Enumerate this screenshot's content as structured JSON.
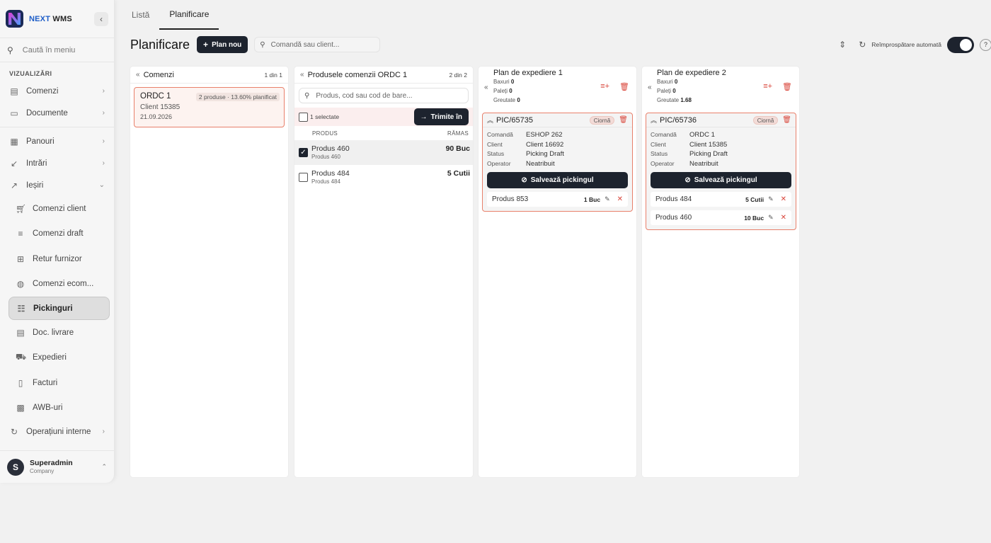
{
  "brand": {
    "name_accent": "NEXT",
    "name": "WMS"
  },
  "sidebar": {
    "search_placeholder": "Caută în meniu",
    "section": "VIZUALIZĂRI",
    "group1": [
      {
        "label": "Comenzi"
      },
      {
        "label": "Documente"
      }
    ],
    "group2": [
      {
        "label": "Panouri"
      },
      {
        "label": "Intrări"
      },
      {
        "label": "Ieșiri"
      }
    ],
    "subitems": [
      {
        "label": "Comenzi client"
      },
      {
        "label": "Comenzi draft"
      },
      {
        "label": "Retur furnizor"
      },
      {
        "label": "Comenzi ecom..."
      },
      {
        "label": "Pickinguri"
      },
      {
        "label": "Doc. livrare"
      },
      {
        "label": "Expedieri"
      },
      {
        "label": "Facturi"
      },
      {
        "label": "AWB-uri"
      }
    ],
    "group3": [
      {
        "label": "Operațiuni interne"
      }
    ],
    "user": {
      "initial": "S",
      "name": "Superadmin",
      "company": "Company"
    }
  },
  "tabs": [
    {
      "label": "Listă"
    },
    {
      "label": "Planificare"
    }
  ],
  "toolbar": {
    "title": "Planificare",
    "new_plan": "Plan nou",
    "search_placeholder": "Comandă sau client...",
    "auto_refresh": "Reîmprospătare automată",
    "auto_refresh_on": true
  },
  "orders_panel": {
    "title": "Comenzi",
    "count": "1 din 1",
    "orders": [
      {
        "id": "ORDC 1",
        "badge": "2 produse · 13.60% planificat",
        "client": "Client 15385",
        "date": "21.09.2026"
      }
    ]
  },
  "products_panel": {
    "title": "Produsele comenzii ORDC 1",
    "count": "2 din 2",
    "search_placeholder": "Produs, cod sau cod de bare...",
    "selected": "1 selectate",
    "send_btn": "Trimite în",
    "col_product": "PRODUS",
    "col_remaining": "RĂMAS",
    "rows": [
      {
        "name": "Produs 460",
        "code": "Produs 460",
        "qty": "90 Buc",
        "checked": true
      },
      {
        "name": "Produs 484",
        "code": "Produs 484",
        "qty": "5 Cutii",
        "checked": false
      }
    ]
  },
  "plans": [
    {
      "title": "Plan de expediere 1",
      "boxes_label": "Baxuri",
      "boxes": "0",
      "pallets_label": "Paleți",
      "pallets": "0",
      "weight_label": "Greutate",
      "weight": "0",
      "picking": {
        "code": "PIC/65735",
        "status_badge": "Ciornă",
        "order_label": "Comandă",
        "order": "ESHOP 262",
        "client_label": "Client",
        "client": "Client 16692",
        "status_label": "Status",
        "status": "Picking Draft",
        "operator_label": "Operator",
        "operator": "Neatribuit",
        "save": "Salvează pickingul",
        "lines": [
          {
            "name": "Produs 853",
            "qty": "1 Buc"
          }
        ]
      }
    },
    {
      "title": "Plan de expediere 2",
      "boxes_label": "Baxuri",
      "boxes": "0",
      "pallets_label": "Paleți",
      "pallets": "0",
      "weight_label": "Greutate",
      "weight": "1.68",
      "picking": {
        "code": "PIC/65736",
        "status_badge": "Ciornă",
        "order_label": "Comandă",
        "order": "ORDC 1",
        "client_label": "Client",
        "client": "Client 15385",
        "status_label": "Status",
        "status": "Picking Draft",
        "operator_label": "Operator",
        "operator": "Neatribuit",
        "save": "Salvează pickingul",
        "lines": [
          {
            "name": "Produs 484",
            "qty": "5 Cutii"
          },
          {
            "name": "Produs 460",
            "qty": "10 Buc"
          }
        ]
      }
    }
  ]
}
